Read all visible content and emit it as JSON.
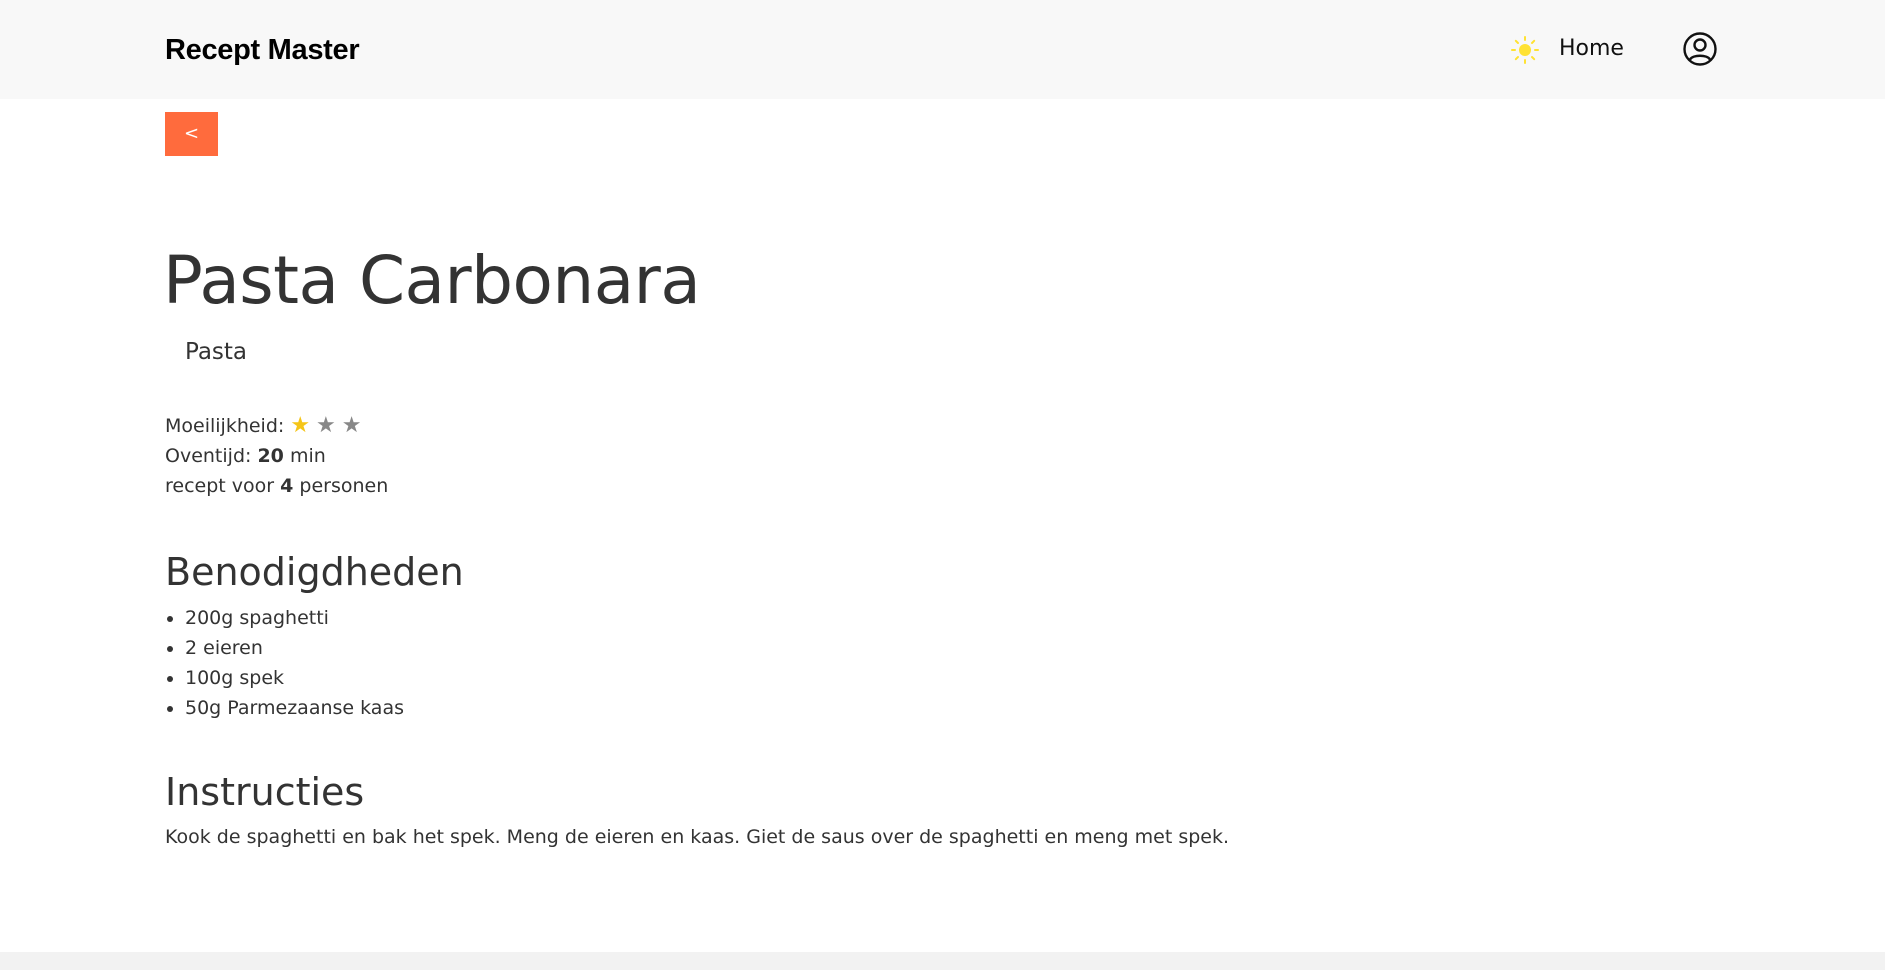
{
  "header": {
    "brand": "Recept Master",
    "nav_home": "Home",
    "theme_icon": "sun-icon",
    "profile_icon": "user-circle-icon"
  },
  "back_button": {
    "label": "<"
  },
  "recipe": {
    "title": "Pasta Carbonara",
    "category": "Pasta",
    "difficulty": {
      "label": "Moeilijkheid:",
      "rating": 1,
      "max": 3,
      "star_glyph": "★"
    },
    "oven": {
      "label": "Oventijd:",
      "value": "20",
      "unit": "min"
    },
    "servings": {
      "prefix": "recept voor",
      "value": "4",
      "suffix": "personen"
    },
    "ingredients_heading": "Benodigdheden",
    "ingredients": [
      "200g spaghetti",
      "2 eieren",
      "100g spek",
      "50g Parmezaanse kaas"
    ],
    "instructions_heading": "Instructies",
    "instructions": "Kook de spaghetti en bak het spek. Meng de eieren en kaas. Giet de saus over de spaghetti en meng met spek."
  },
  "colors": {
    "accent": "#ff6b3d",
    "star_filled": "#f5c518",
    "star_empty": "#888888",
    "sun": "#ffe233",
    "navbar_bg": "#f8f8f8"
  }
}
